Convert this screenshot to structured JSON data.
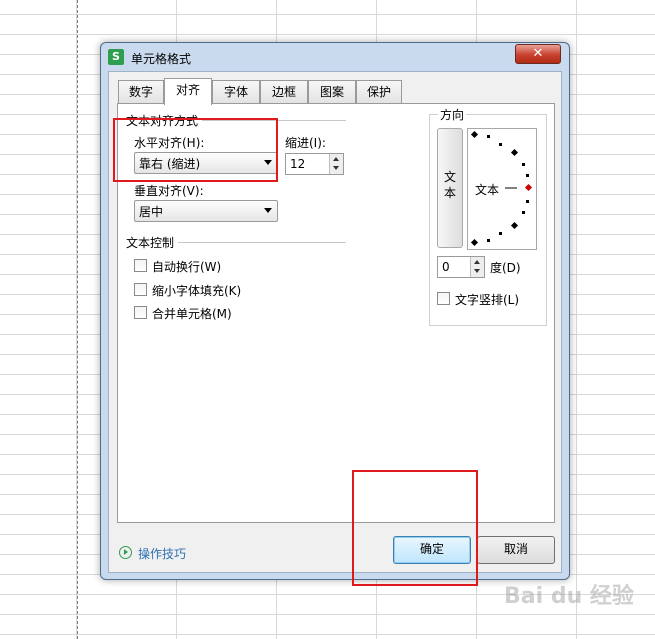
{
  "dialog": {
    "title": "单元格格式",
    "app_icon": "S",
    "close_glyph": "✕"
  },
  "tabs": [
    {
      "label": "数字",
      "active": false
    },
    {
      "label": "对齐",
      "active": true
    },
    {
      "label": "字体",
      "active": false
    },
    {
      "label": "边框",
      "active": false
    },
    {
      "label": "图案",
      "active": false
    },
    {
      "label": "保护",
      "active": false
    }
  ],
  "alignment": {
    "group_title": "文本对齐方式",
    "horizontal_label": "水平对齐(H):",
    "horizontal_value": "靠右 (缩进)",
    "indent_label": "缩进(I):",
    "indent_value": "12",
    "vertical_label": "垂直对齐(V):",
    "vertical_value": "居中"
  },
  "text_control": {
    "group_title": "文本控制",
    "wrap_text": "自动换行(W)",
    "shrink_to_fit": "缩小字体填充(K)",
    "merge_cells": "合并单元格(M)"
  },
  "orientation": {
    "group_title": "方向",
    "vertical_text": "文本",
    "dial_text": "文本",
    "degrees_value": "0",
    "degrees_label": "度(D)",
    "stacked_text": "文字竖排(L)",
    "dial_marker_color": "#cc0000"
  },
  "footer": {
    "tips_link": "操作技巧",
    "ok_button": "确定",
    "cancel_button": "取消"
  },
  "highlight_color": "#e0191d",
  "watermark": "Bai du 经验"
}
